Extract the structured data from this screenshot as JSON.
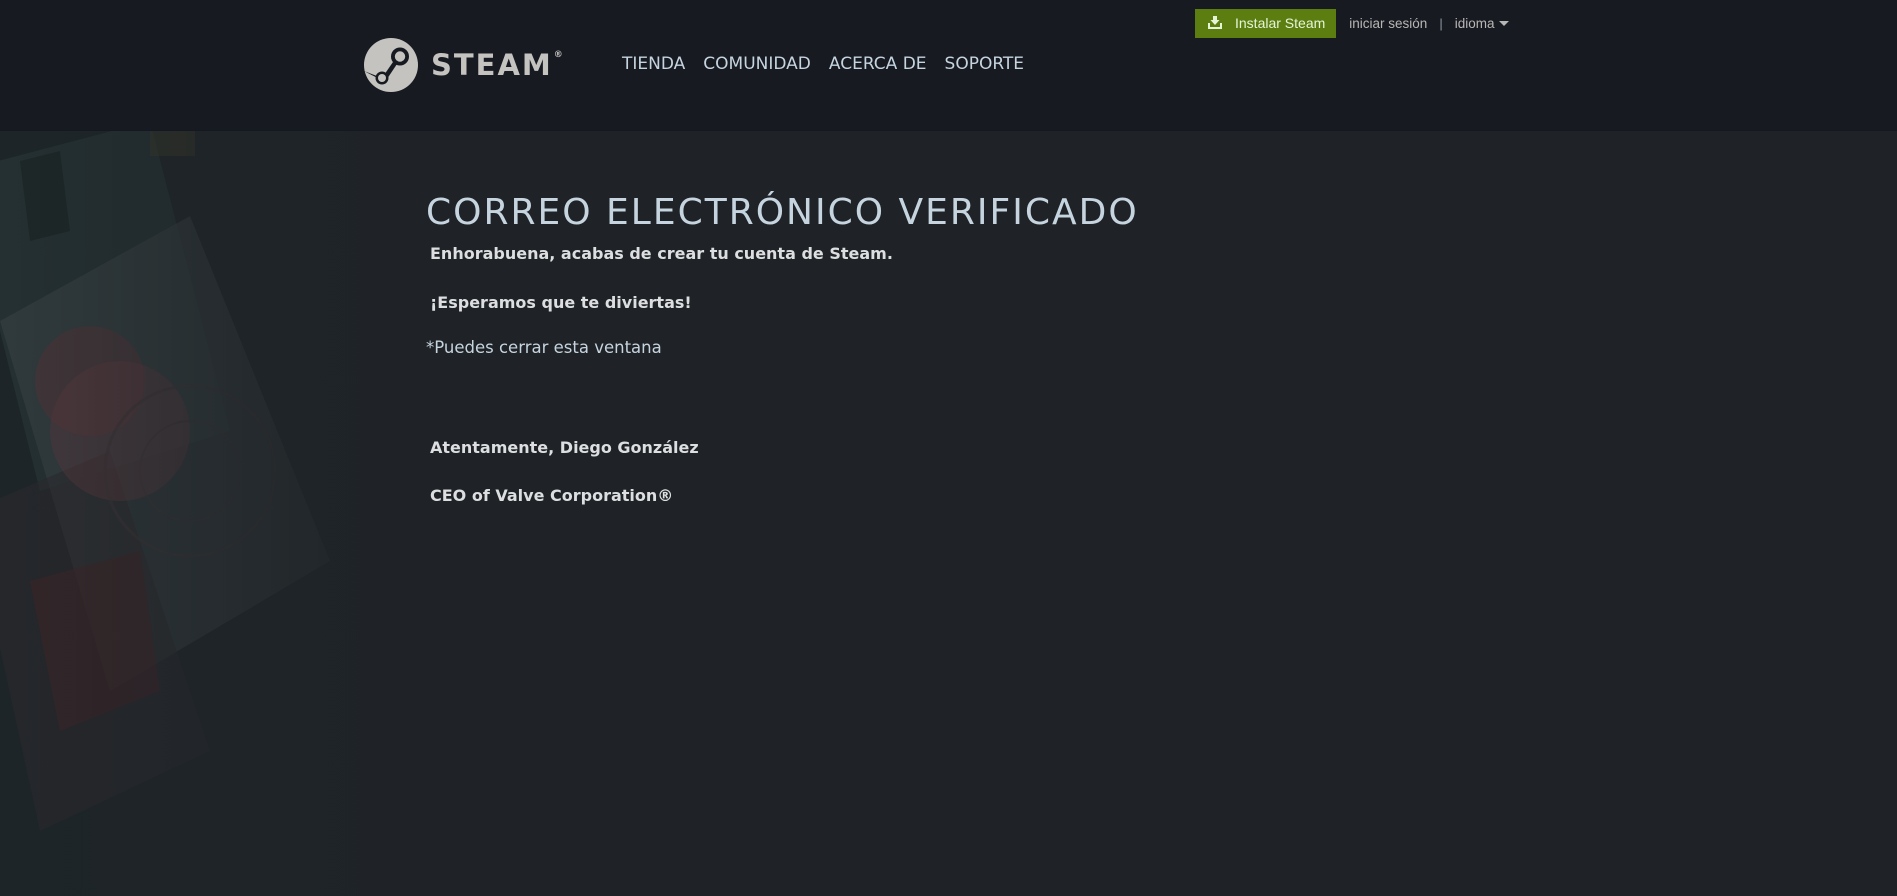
{
  "header": {
    "logo_text": "STEAM",
    "logo_reg": "®",
    "nav": [
      "TIENDA",
      "COMUNIDAD",
      "ACERCA DE",
      "SOPORTE"
    ],
    "install_label": "Instalar Steam",
    "login_label": "iniciar sesión",
    "separator": "|",
    "language_label": "idioma"
  },
  "main": {
    "title": "CORREO ELECTRÓNICO VERIFICADO",
    "congrats": "Enhorabuena, acabas de crear tu cuenta de Steam.",
    "hope": "¡Esperamos que te diviertas!",
    "close_note": "*Puedes cerrar esta ventana",
    "signature": "Atentamente, Diego González",
    "signature_title": "CEO of Valve Corporation®"
  },
  "colors": {
    "header_bg": "#171a21",
    "page_bg": "#1f2327",
    "install_button": "#5c7e10",
    "text_primary": "#c6d4df"
  },
  "icons": [
    "steam-logo-icon",
    "download-icon",
    "caret-down-icon"
  ]
}
